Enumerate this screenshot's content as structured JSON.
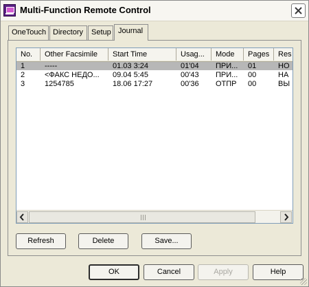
{
  "window": {
    "title": "Multi-Function Remote Control"
  },
  "tabs": [
    {
      "label": "OneTouch"
    },
    {
      "label": "Directory"
    },
    {
      "label": "Setup"
    },
    {
      "label": "Journal"
    }
  ],
  "journal": {
    "columns": [
      "No.",
      "Other Facsimile",
      "Start Time",
      "Usag...",
      "Mode",
      "Pages",
      "Res"
    ],
    "rows": [
      {
        "no": "1",
        "facsimile": "-----",
        "start": "01.03 3:24",
        "usage": "01'04",
        "mode": "ПРИ...",
        "pages": "01",
        "result": "НО"
      },
      {
        "no": "2",
        "facsimile": "<ФАКС НЕДО...",
        "start": "09.04 5:45",
        "usage": "00'43",
        "mode": "ПРИ...",
        "pages": "00",
        "result": "НА"
      },
      {
        "no": "3",
        "facsimile": "1254785",
        "start": "18.06 17:27",
        "usage": "00'36",
        "mode": "ОТПР",
        "pages": "00",
        "result": "ВЫ"
      }
    ],
    "buttons": {
      "refresh": "Refresh",
      "delete": "Delete",
      "save": "Save..."
    }
  },
  "dialog_buttons": {
    "ok": "OK",
    "cancel": "Cancel",
    "apply": "Apply",
    "help": "Help"
  }
}
